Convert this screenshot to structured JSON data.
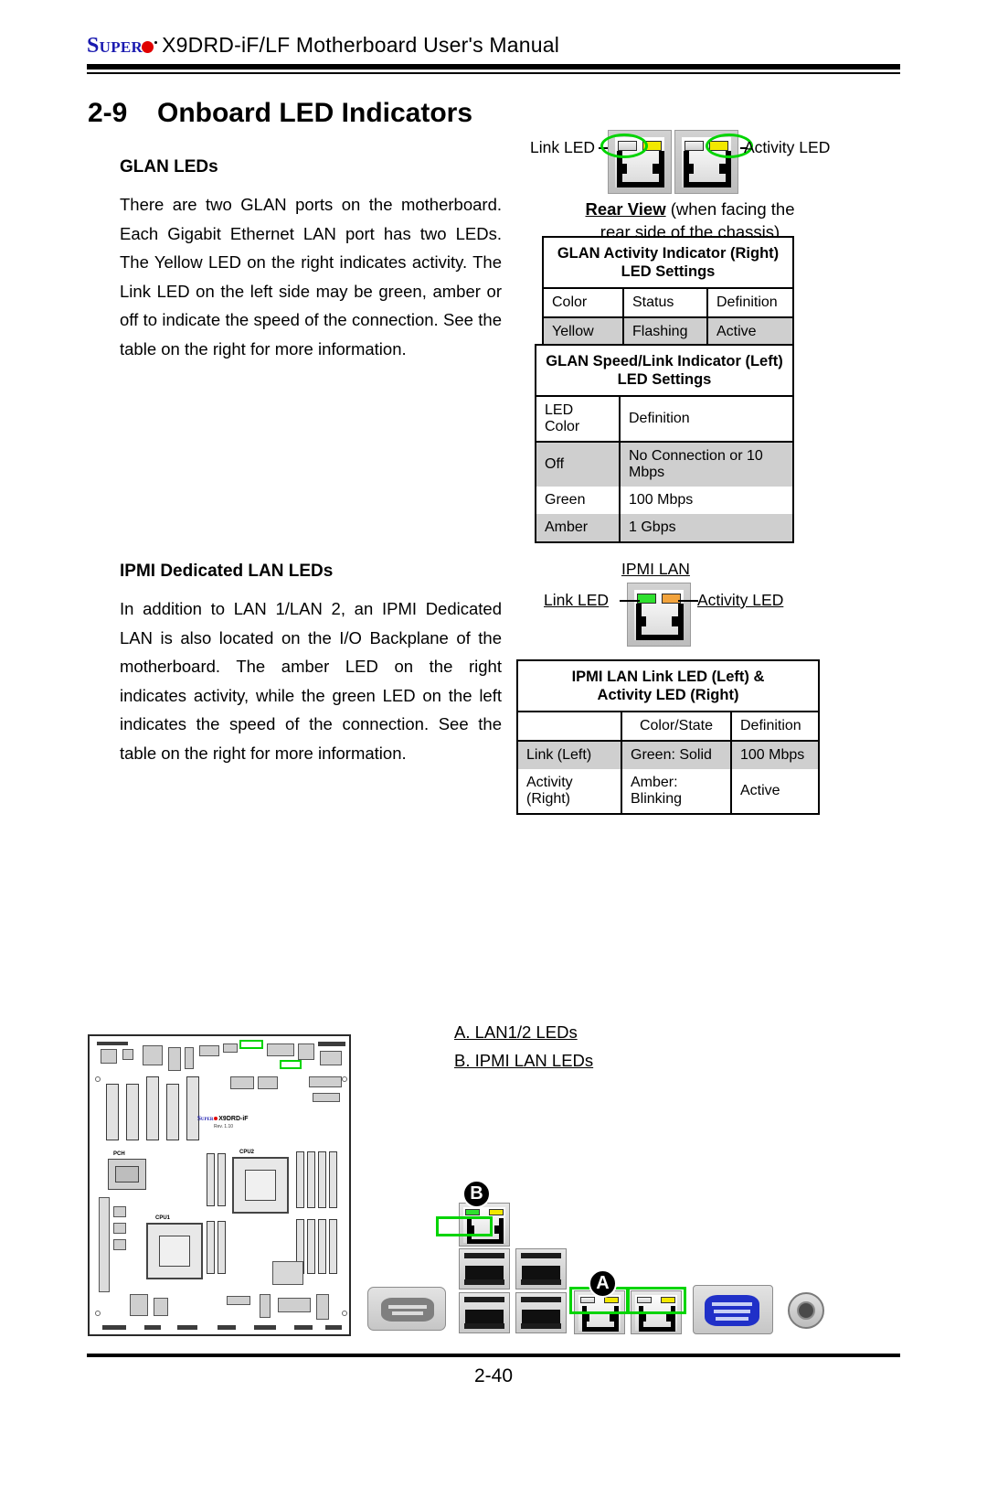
{
  "header": {
    "brand_super": "Super",
    "brand_dot_icon": "red-dot-icon",
    "title": "X9DRD-iF/LF Motherboard User's Manual"
  },
  "section": {
    "number": "2-9",
    "title": "Onboard LED Indicators"
  },
  "glan": {
    "heading": "GLAN LEDs",
    "body": "There are two GLAN ports on the motherboard. Each Gigabit Ethernet LAN port has two LEDs. The Yellow LED on the right indicates activity. The Link LED on the left side may be green, amber or off to indicate the speed of the connection. See the table on the right for more information.",
    "diagram": {
      "link_label": "Link LED",
      "activity_label": "Activity LED",
      "caption_bold": "Rear View",
      "caption_rest": " (when facing the",
      "caption_line2": "rear side of the chassis)"
    },
    "activity_table": {
      "title_line1": "GLAN Activity Indicator (Right)",
      "title_line2": "LED Settings",
      "columns": [
        "Color",
        "Status",
        "Definition"
      ],
      "rows": [
        [
          "Yellow",
          "Flashing",
          "Active"
        ]
      ]
    },
    "speed_table": {
      "title_line1": "GLAN Speed/Link Indicator (Left)",
      "title_line2": "LED Settings",
      "columns": [
        "LED Color",
        "Definition"
      ],
      "rows": [
        [
          "Off",
          "No Connection or 10 Mbps"
        ],
        [
          "Green",
          "100 Mbps"
        ],
        [
          "Amber",
          "1 Gbps"
        ]
      ]
    }
  },
  "ipmi": {
    "heading": "IPMI Dedicated LAN LEDs",
    "body": "In addition to LAN 1/LAN 2, an IPMI Dedicated LAN is also located on the I/O Backplane of the motherboard. The amber LED on the right indicates activity, while the green LED on the left indicates the speed of the connection. See the table on the right for more information.",
    "diagram": {
      "port_label": "IPMI LAN",
      "link_label": "Link LED",
      "activity_label": "Activity LED"
    },
    "table": {
      "title_line1": "IPMI LAN Link LED (Left) &",
      "title_line2": "Activity LED (Right)",
      "columns": [
        "",
        "Color/State",
        "Definition"
      ],
      "rows": [
        [
          "Link (Left)",
          "Green: Solid",
          "100 Mbps"
        ],
        [
          "Activity (Right)",
          "Amber: Blinking",
          "Active"
        ]
      ]
    }
  },
  "callouts": {
    "a_label": "A",
    "b_label": "B",
    "list": [
      "A. LAN1/2 LEDs",
      "B. IPMI LAN LEDs"
    ]
  },
  "motherboard": {
    "logo_super": "Super",
    "logo_model": "X9DRD-iF",
    "logo_rev": "Rev. 1.10",
    "cpu1": "CPU1",
    "cpu2": "CPU2",
    "pch": "PCH"
  },
  "footer": {
    "page_number": "2-40"
  },
  "colors": {
    "brand_blue": "#1a1ab0",
    "brand_red": "#e00000",
    "highlight_green": "#00d400",
    "led_yellow": "#f2e800",
    "led_green": "#2ee02e",
    "led_amber": "#f2a33c",
    "table_shade": "#cfcfcf"
  }
}
